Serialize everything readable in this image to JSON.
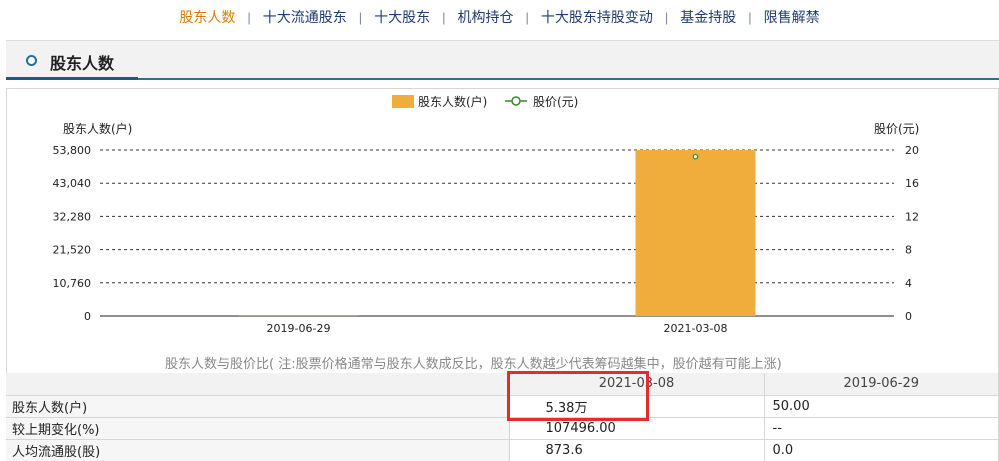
{
  "nav": {
    "items": [
      {
        "label": "股东人数",
        "active": true
      },
      {
        "label": "十大流通股东",
        "active": false
      },
      {
        "label": "十大股东",
        "active": false
      },
      {
        "label": "机构持仓",
        "active": false
      },
      {
        "label": "十大股东持股变动",
        "active": false
      },
      {
        "label": "基金持股",
        "active": false
      },
      {
        "label": "限售解禁",
        "active": false
      }
    ],
    "separator": "|"
  },
  "section": {
    "title": "股东人数"
  },
  "colors": {
    "bar": "#F0AD3C",
    "line": "#3a8a2a",
    "accent": "#e07b00",
    "highlight": "#e52b2b"
  },
  "chart_data": {
    "type": "bar",
    "categories": [
      "2019-06-29",
      "2021-03-08"
    ],
    "series": [
      {
        "name": "股东人数(户)",
        "type": "bar",
        "axis": "left",
        "values": [
          50,
          53800
        ]
      },
      {
        "name": "股价(元)",
        "type": "line",
        "axis": "right",
        "values": [
          null,
          19.2
        ]
      }
    ],
    "ylabel_left": "股东人数(户)",
    "ylabel_right": "股价(元)",
    "ylim_left": [
      0,
      53800
    ],
    "ylim_right": [
      0,
      20
    ],
    "yticks_left": [
      "0",
      "10,760",
      "21,520",
      "32,280",
      "43,040",
      "53,800"
    ],
    "yticks_right": [
      "0",
      "4",
      "8",
      "12",
      "16",
      "20"
    ],
    "grid": true,
    "legend": "top-center",
    "caption": "股东人数与股价比( 注:股票价格通常与股东人数成反比，股东人数越少代表筹码越集中，股价越有可能上涨)"
  },
  "table": {
    "dates": [
      "2021-03-08",
      "2019-06-29"
    ],
    "rows": [
      {
        "label": "股东人数(户)",
        "values": [
          "5.38万",
          "50.00"
        ]
      },
      {
        "label": "较上期变化(%)",
        "values": [
          "107496.00",
          "--"
        ]
      },
      {
        "label": "人均流通股(股)",
        "values": [
          "873.6",
          "0.0"
        ]
      }
    ]
  }
}
